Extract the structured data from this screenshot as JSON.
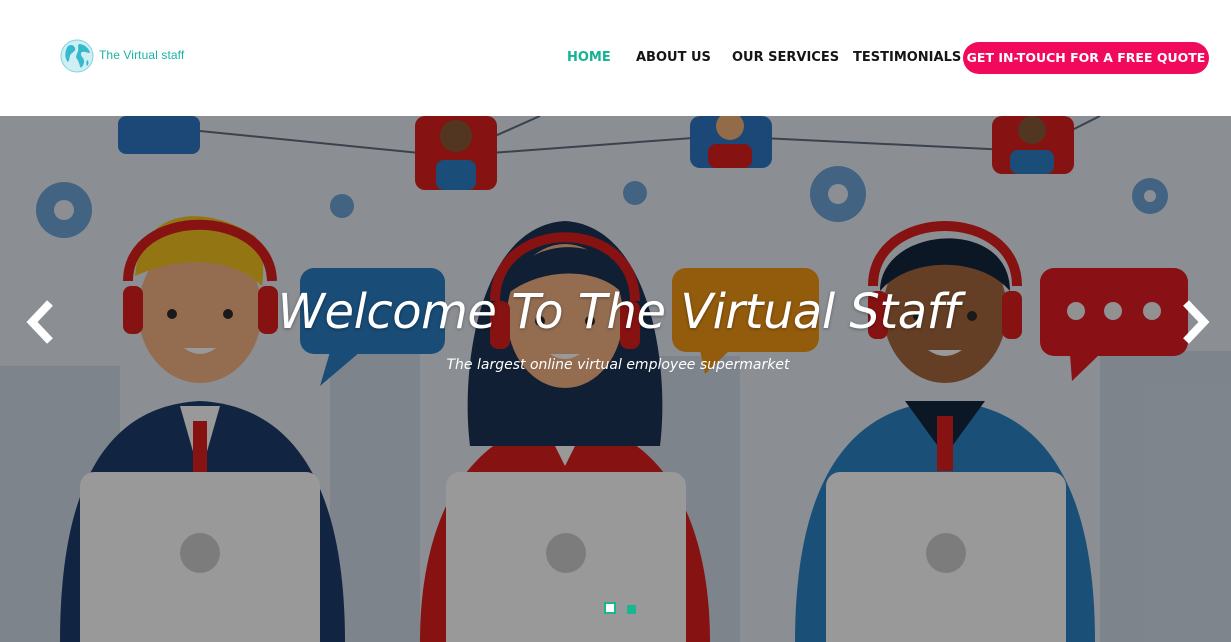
{
  "brand": {
    "name": "The Virtual staff"
  },
  "nav": {
    "items": [
      {
        "label": "HOME",
        "active": true
      },
      {
        "label": "ABOUT US",
        "active": false
      },
      {
        "label": "OUR SERVICES",
        "active": false
      },
      {
        "label": "TESTIMONIALS",
        "active": false
      }
    ],
    "cta": "GET IN-TOUCH FOR A FREE QUOTE"
  },
  "hero": {
    "title": "Welcome To The Virtual Staff",
    "subtitle": "The largest online virtual employee supermarket",
    "active_slide": 1,
    "slide_count": 2
  },
  "colors": {
    "accent": "#16b392",
    "cta": "#f10a5c",
    "logo": "#19b3a6"
  },
  "icons": {
    "logo": "globe-icon",
    "prev": "chevron-left-icon",
    "next": "chevron-right-icon"
  }
}
